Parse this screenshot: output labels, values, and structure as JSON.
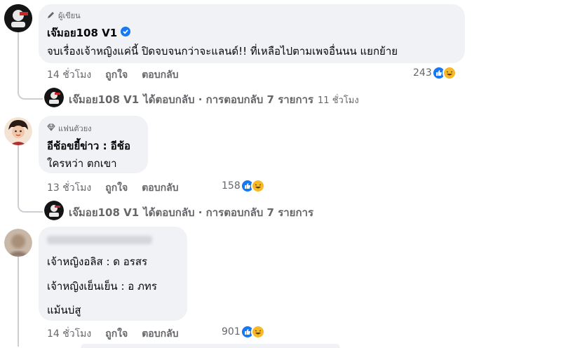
{
  "comments": [
    {
      "badge": "ผู้เขียน",
      "author": "เจ๊มอย108 V1",
      "text": "จบเรื่องเจ้าหญิงแค่นี้ ปิดจบจนกว่าจะแลนด์!! ที่เหลือไปตามเพจอื่นนน แยกย้าย",
      "time": "14 ชั่วโมง",
      "like": "ถูกใจ",
      "reply": "ตอบกลับ",
      "reactions": "243",
      "reply_summary": {
        "author": "เจ๊มอย108 V1",
        "text": "ได้ตอบกลับ · การตอบกลับ 7 รายการ",
        "ago": "11 ชั่วโมง"
      }
    },
    {
      "badge": "แฟนตัวยง",
      "lines": [
        "อีช้อขยี้ข่าว : อีช้อ",
        "ใครหว่า ตกเขา"
      ],
      "time": "13 ชั่วโมง",
      "like": "ถูกใจ",
      "reply": "ตอบกลับ",
      "reactions": "158",
      "reply_summary": {
        "author": "เจ๊มอย108 V1",
        "text": "ได้ตอบกลับ · การตอบกลับ 7 รายการ"
      }
    },
    {
      "lines": [
        "เจ้าหญิงอลิส : ด อรสร",
        "เจ้าหญิงเย็นเย็น : อ ภทร",
        "แม้นบ่สู"
      ],
      "time": "14 ชั่วโมง",
      "like": "ถูกใจ",
      "reply": "ตอบกลับ",
      "reactions": "901"
    }
  ],
  "colors": {
    "bubble": "#f0f2f5",
    "verified": "#1877f2",
    "like": "#1877f2",
    "haha": "#f7b928",
    "meta": "#65676b"
  },
  "icons": [
    "pen-icon",
    "verified-icon",
    "diamond-icon",
    "like-reaction-icon",
    "haha-reaction-icon"
  ]
}
